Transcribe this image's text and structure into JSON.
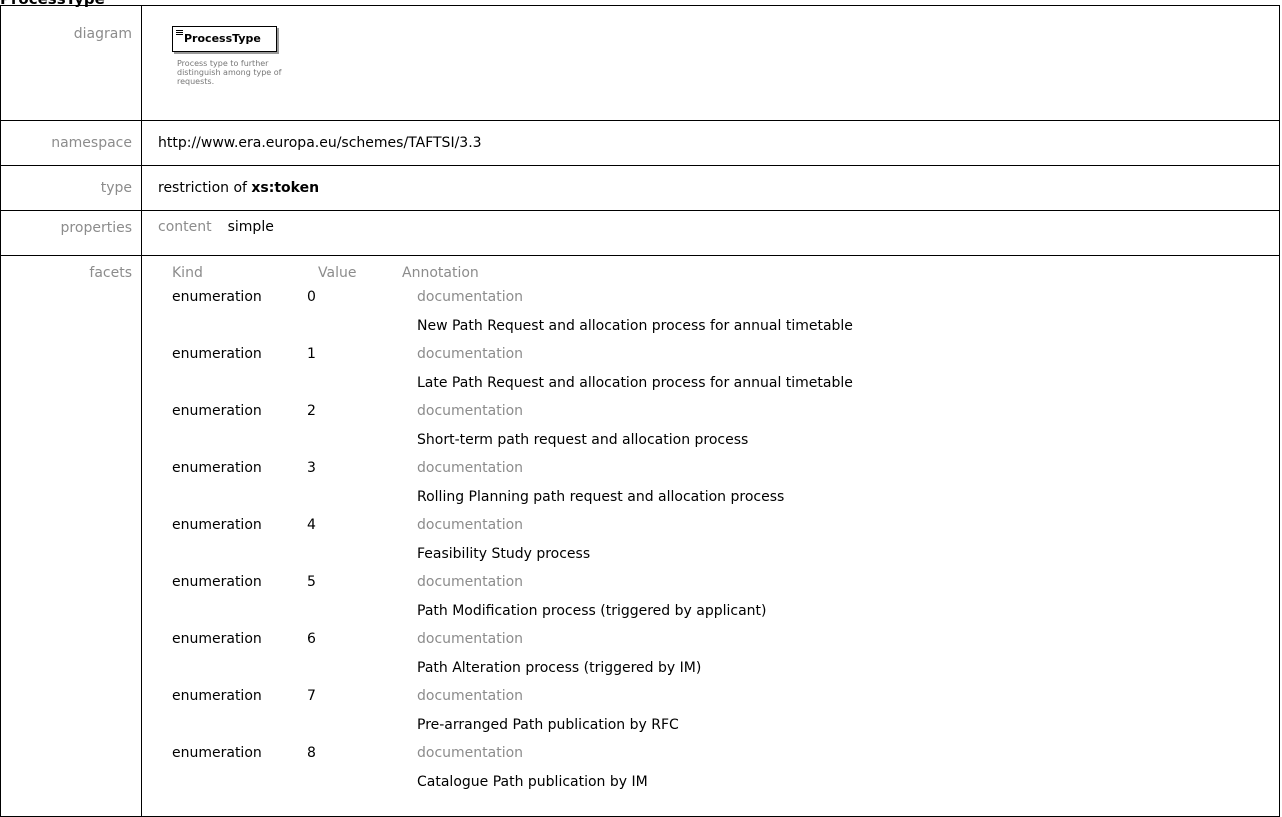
{
  "title": "ProcessType",
  "rows": {
    "diagram": {
      "label": "diagram",
      "box_label": "ProcessType",
      "box_doc": "Process type to further distinguish among type of requests."
    },
    "namespace": {
      "label": "namespace",
      "value": "http://www.era.europa.eu/schemes/TAFTSI/3.3"
    },
    "type": {
      "label": "type",
      "prefix": "restriction of",
      "base": "xs:token"
    },
    "properties": {
      "label": "properties",
      "key": "content",
      "value": "simple"
    },
    "facets": {
      "label": "facets",
      "headers": {
        "kind": "Kind",
        "value": "Value",
        "annotation": "Annotation"
      },
      "items": [
        {
          "kind": "enumeration",
          "value": "0",
          "doc_label": "documentation",
          "doc": "New Path Request and allocation process for annual timetable"
        },
        {
          "kind": "enumeration",
          "value": "1",
          "doc_label": "documentation",
          "doc": "Late Path Request and allocation process for annual timetable"
        },
        {
          "kind": "enumeration",
          "value": "2",
          "doc_label": "documentation",
          "doc": "Short-term path request and allocation process"
        },
        {
          "kind": "enumeration",
          "value": "3",
          "doc_label": "documentation",
          "doc": "Rolling Planning path request and allocation process"
        },
        {
          "kind": "enumeration",
          "value": "4",
          "doc_label": "documentation",
          "doc": "Feasibility Study process"
        },
        {
          "kind": "enumeration",
          "value": "5",
          "doc_label": "documentation",
          "doc": "Path Modification process (triggered by applicant)"
        },
        {
          "kind": "enumeration",
          "value": "6",
          "doc_label": "documentation",
          "doc": "Path Alteration process (triggered by IM)"
        },
        {
          "kind": "enumeration",
          "value": "7",
          "doc_label": "documentation",
          "doc": "Pre-arranged Path publication by RFC"
        },
        {
          "kind": "enumeration",
          "value": "8",
          "doc_label": "documentation",
          "doc": "Catalogue Path publication by IM"
        }
      ]
    }
  }
}
